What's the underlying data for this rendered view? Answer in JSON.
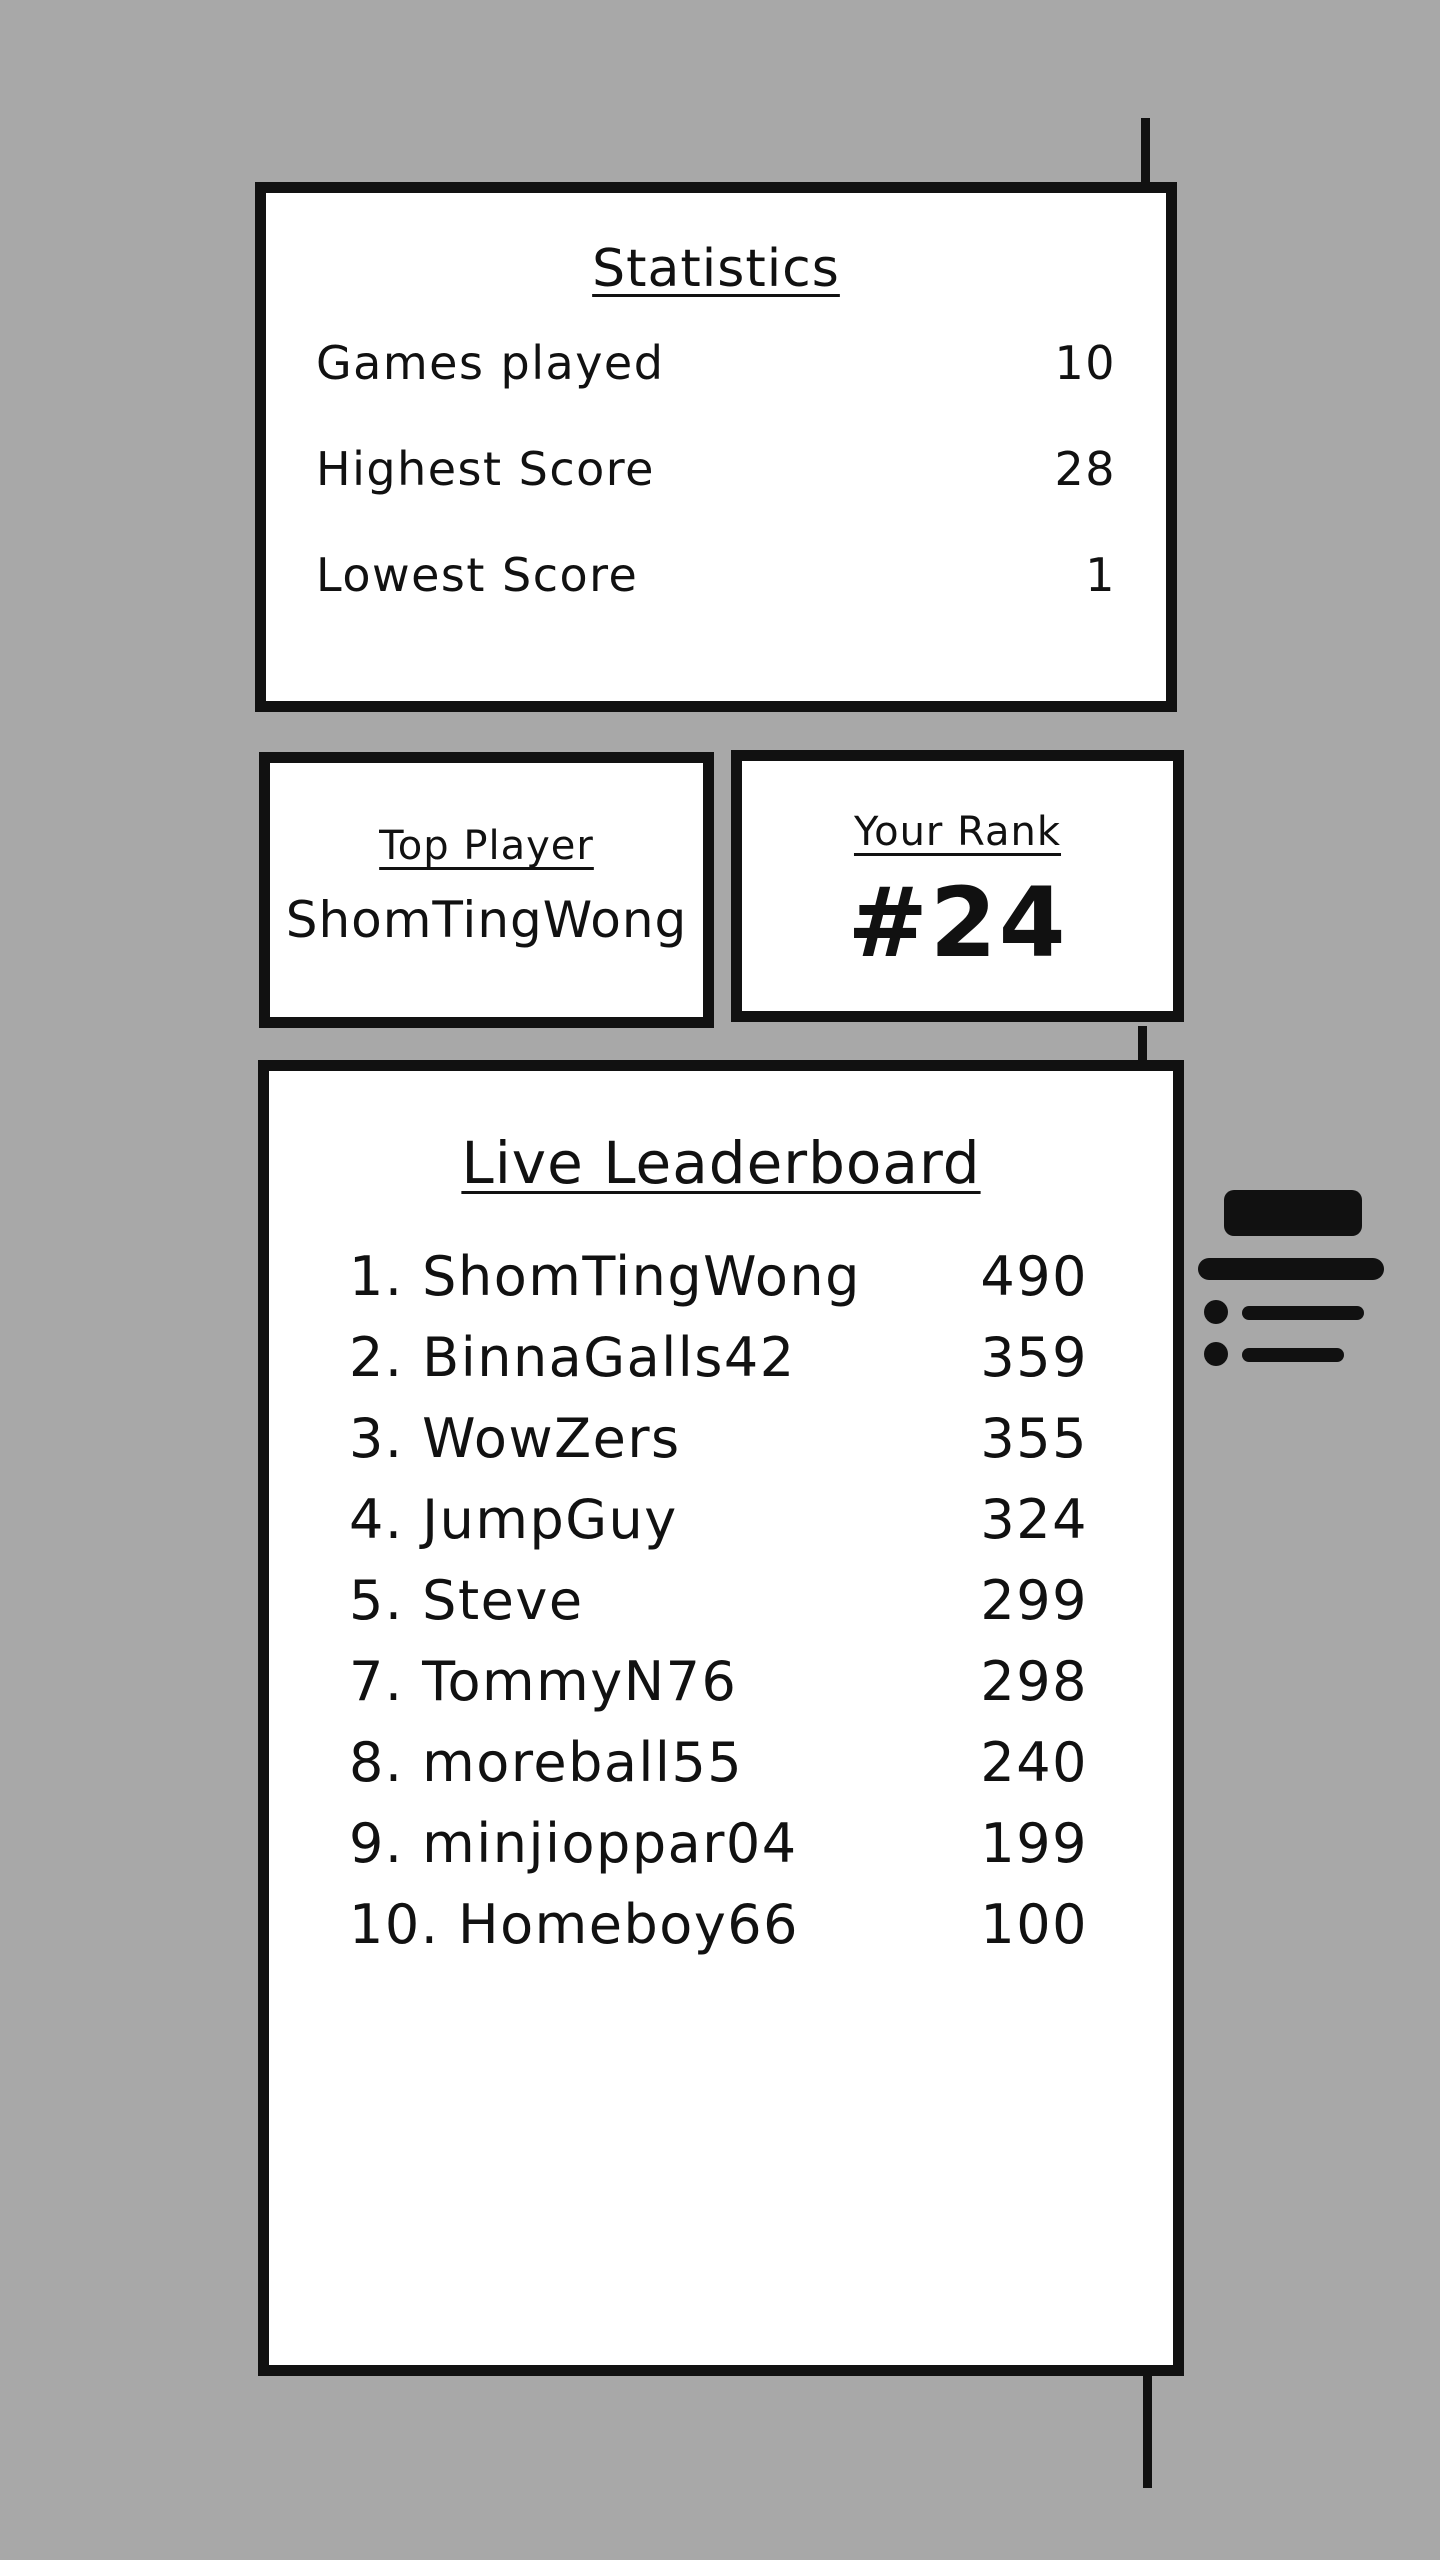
{
  "statistics": {
    "title": "Statistics",
    "rows": [
      {
        "label": "Games played",
        "value": "10"
      },
      {
        "label": "Highest Score",
        "value": "28"
      },
      {
        "label": "Lowest Score",
        "value": "1"
      }
    ]
  },
  "top_player": {
    "title": "Top Player",
    "name": "ShomTingWong"
  },
  "your_rank": {
    "title": "Your Rank",
    "value": "#24"
  },
  "leaderboard": {
    "title": "Live Leaderboard",
    "entries": [
      {
        "player": "1. ShomTingWong",
        "score": "490"
      },
      {
        "player": "2. BinnaGalls42",
        "score": "359"
      },
      {
        "player": "3. WowZers",
        "score": "355"
      },
      {
        "player": "4. JumpGuy",
        "score": "324"
      },
      {
        "player": "5. Steve",
        "score": "299"
      },
      {
        "player": "7. TommyN76",
        "score": "298"
      },
      {
        "player": "8. moreball55",
        "score": "240"
      },
      {
        "player": "9. minjioppar04",
        "score": "199"
      },
      {
        "player": "10. Homeboy66",
        "score": "100"
      }
    ]
  },
  "icons": {
    "menu": "menu-list-icon"
  },
  "colors": {
    "background": "#a8a8a8",
    "panel": "#ffffff",
    "ink": "#111111"
  }
}
